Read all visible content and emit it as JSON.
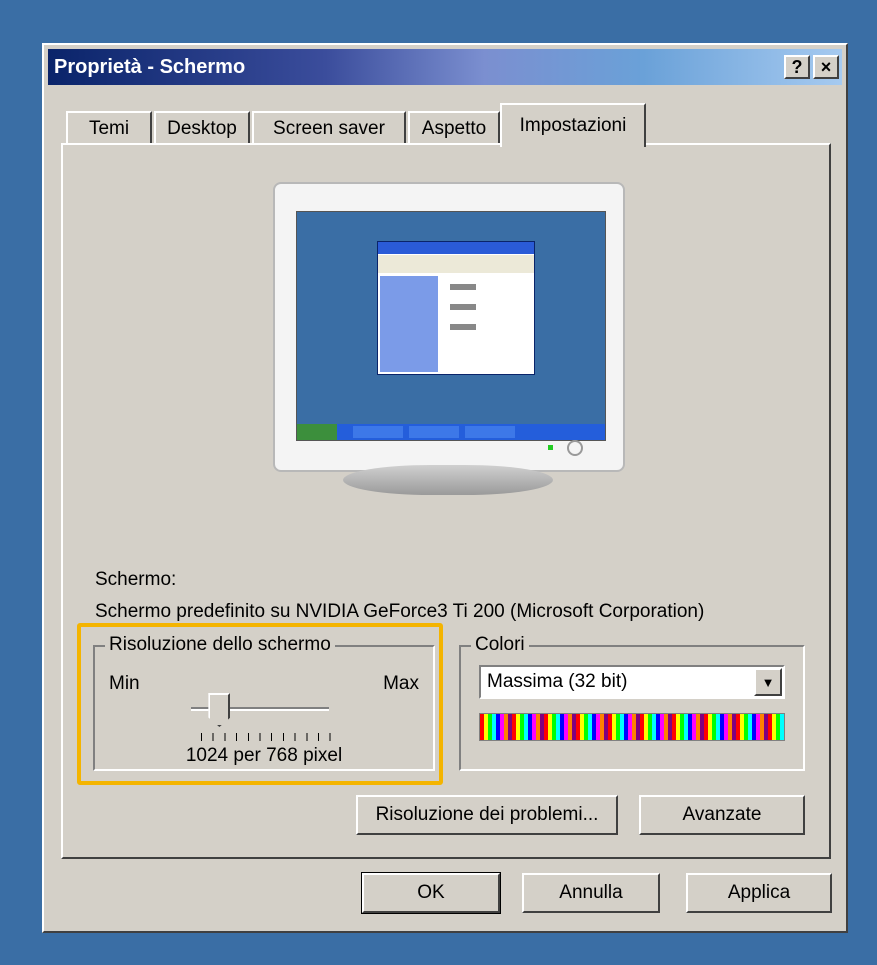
{
  "window": {
    "title": "Proprietà - Schermo",
    "help_label": "?",
    "close_label": "×"
  },
  "tabs": [
    {
      "label": "Temi"
    },
    {
      "label": "Desktop"
    },
    {
      "label": "Screen saver"
    },
    {
      "label": "Aspetto"
    },
    {
      "label": "Impostazioni",
      "active": true
    }
  ],
  "display": {
    "label": "Schermo:",
    "device": "Schermo predefinito su NVIDIA GeForce3 Ti 200 (Microsoft Corporation)"
  },
  "resolution": {
    "legend": "Risoluzione dello schermo",
    "min_label": "Min",
    "max_label": "Max",
    "value_text": "1024 per 768 pixel",
    "slider_position": 0.15
  },
  "colors": {
    "legend": "Colori",
    "selected": "Massima (32 bit)"
  },
  "buttons": {
    "troubleshoot": "Risoluzione dei problemi...",
    "advanced": "Avanzate",
    "ok": "OK",
    "cancel": "Annulla",
    "apply": "Applica"
  },
  "accent": {
    "highlight": "#f4b400",
    "titlebar": "#0a246a",
    "desktop": "#3a6ea5"
  }
}
